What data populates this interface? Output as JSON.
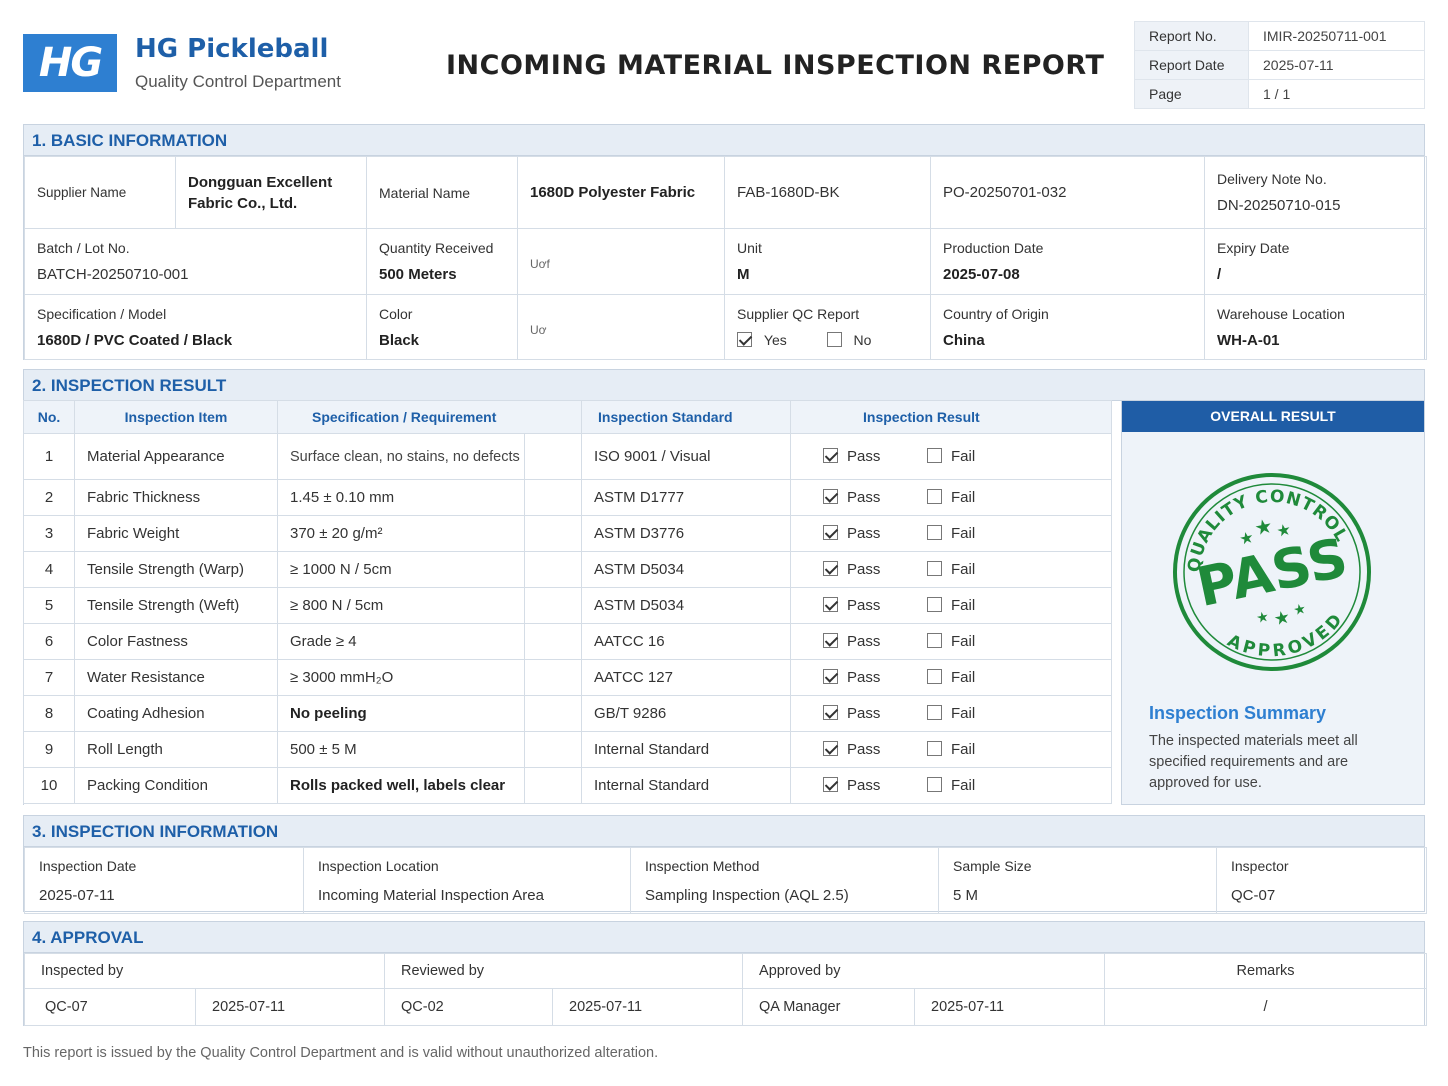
{
  "header": {
    "logo_text": "HG",
    "company": "HG Pickleball",
    "department": "Quality Control Department",
    "title": "INCOMING MATERIAL INSPECTION REPORT",
    "meta": [
      {
        "label": "Report No.",
        "value": "IMIR-20250711-001"
      },
      {
        "label": "Report Date",
        "value": "2025-07-11"
      },
      {
        "label": "Page",
        "value": "1 / 1"
      }
    ]
  },
  "basic_info": {
    "heading": "1. BASIC INFORMATION",
    "supplier_label": "Supplier Name",
    "supplier_value": "Dongguan Excellent Fabric Co., Ltd.",
    "material_label": "Material Name",
    "material_value": "1680D Polyester Fabric",
    "material_code": "FAB-1680D-BK",
    "po_number": "PO-20250701-032",
    "delivery_label": "Delivery Note No.",
    "delivery_value": "DN-20250710-015",
    "batch_label": "Batch / Lot No.",
    "batch_value": "BATCH-20250710-001",
    "qty_label": "Quantity Received",
    "qty_value": "500 Meters",
    "qty_mark": "Uơf",
    "unit_label": "Unit",
    "unit_value": "M",
    "prod_label": "Production Date",
    "prod_value": "2025-07-08",
    "expiry_label": "Expiry Date",
    "expiry_value": "/",
    "spec_label": "Specification / Model",
    "spec_value": "1680D / PVC Coated / Black",
    "color_label": "Color",
    "color_value": "Black",
    "color_mark": "Uơ",
    "qc_label": "Supplier QC Report",
    "qc_yes": "Yes",
    "qc_no": "No",
    "qc_selected": "Yes",
    "origin_label": "Country of Origin",
    "origin_value": "China",
    "wh_label": "Warehouse Location",
    "wh_value": "WH-A-01"
  },
  "inspection_result": {
    "heading": "2. INSPECTION RESULT",
    "columns": [
      "No.",
      "Inspection Item",
      "Specification / Requirement",
      "Inspection Standard",
      "Inspection Result"
    ],
    "pass_label": "Pass",
    "fail_label": "Fail",
    "rows": [
      {
        "no": "1",
        "item": "Material Appearance",
        "spec": "Surface clean, no stains, no defects",
        "standard": "ISO 9001 / Visual",
        "result": "Pass"
      },
      {
        "no": "2",
        "item": "Fabric Thickness",
        "spec": "1.45 ± 0.10 mm",
        "standard": "ASTM D1777",
        "result": "Pass"
      },
      {
        "no": "3",
        "item": "Fabric Weight",
        "spec": "370 ± 20 g/m²",
        "standard": "ASTM D3776",
        "result": "Pass"
      },
      {
        "no": "4",
        "item": "Tensile Strength (Warp)",
        "spec": "≥ 1000 N / 5cm",
        "standard": "ASTM D5034",
        "result": "Pass"
      },
      {
        "no": "5",
        "item": "Tensile Strength (Weft)",
        "spec": "≥ 800 N / 5cm",
        "standard": "ASTM D5034",
        "result": "Pass"
      },
      {
        "no": "6",
        "item": "Color Fastness",
        "spec": "Grade ≥ 4",
        "standard": "AATCC 16",
        "result": "Pass"
      },
      {
        "no": "7",
        "item": "Water Resistance",
        "spec": "≥ 3000 mmH₂O",
        "standard": "AATCC 127",
        "result": "Pass"
      },
      {
        "no": "8",
        "item": "Coating Adhesion",
        "spec": "No peeling",
        "standard": "GB/T 9286",
        "result": "Pass"
      },
      {
        "no": "9",
        "item": "Roll Length",
        "spec": "500 ± 5 M",
        "standard": "Internal Standard",
        "result": "Pass"
      },
      {
        "no": "10",
        "item": "Packing Condition",
        "spec": "Rolls packed well, labels clear",
        "standard": "Internal Standard",
        "result": "Pass"
      }
    ],
    "overall_heading": "OVERALL RESULT",
    "stamp": {
      "top": "QUALITY CONTROL",
      "center": "PASS",
      "bottom": "APPROVED",
      "color": "#1f8a3a"
    },
    "summary_title": "Inspection Summary",
    "summary_text": "The inspected materials meet all specified requirements and are approved for use."
  },
  "inspection_info": {
    "heading": "3. INSPECTION INFORMATION",
    "fields": [
      {
        "label": "Inspection Date",
        "value": "2025-07-11"
      },
      {
        "label": "Inspection Location",
        "value": "Incoming Material Inspection Area"
      },
      {
        "label": "Inspection Method",
        "value": "Sampling Inspection (AQL 2.5)"
      },
      {
        "label": "Sample Size",
        "value": "5 M"
      },
      {
        "label": "Inspector",
        "value": "QC-07"
      }
    ]
  },
  "approval": {
    "heading": "4. APPROVAL",
    "inspected_label": "Inspected by",
    "inspected_name": "QC-07",
    "inspected_date": "2025-07-11",
    "reviewed_label": "Reviewed by",
    "reviewed_name": "QC-02",
    "reviewed_date": "2025-07-11",
    "approved_label": "Approved by",
    "approved_name": "QA Manager",
    "approved_date": "2025-07-11",
    "remarks_label": "Remarks",
    "remarks_value": "/"
  },
  "footer": "This report is issued by the Quality Control Department and is valid without unauthorized alteration.",
  "colors": {
    "brand": "#1e5fa8",
    "logo_bg": "#2e7fd1",
    "section_bg": "#e6edf5",
    "overall_header": "#1f5da6",
    "stamp": "#1f8a3a"
  }
}
